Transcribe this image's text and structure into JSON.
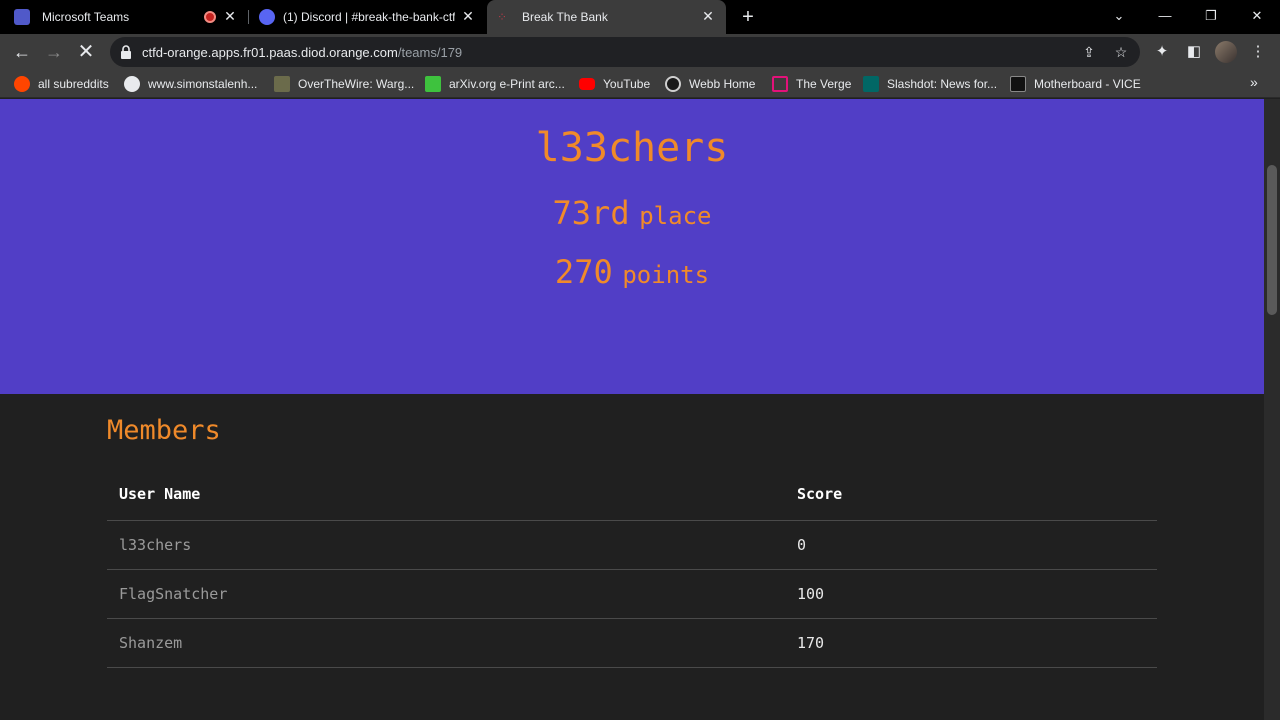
{
  "browser": {
    "tabs": [
      {
        "title": "Microsoft Teams",
        "favicon": "teams-icon",
        "color": "#5059c9"
      },
      {
        "title": "(1) Discord | #break-the-bank-ctf",
        "favicon": "discord-icon",
        "color": "#5865f2"
      },
      {
        "title": "Break The Bank",
        "favicon": "ctf-icon",
        "color": "#b23a48"
      }
    ],
    "url_host": "ctfd-orange.apps.fr01.paas.diod.orange.com",
    "url_path": "/teams/179",
    "bookmarks": [
      {
        "label": "all subreddits",
        "icon": "reddit-icon",
        "color": "#ff4500"
      },
      {
        "label": "www.simonstalenh...",
        "icon": "globe-icon",
        "color": "#e8eaed"
      },
      {
        "label": "OverTheWire: Warg...",
        "icon": "overthewire-icon",
        "color": "#6b6b4b"
      },
      {
        "label": "arXiv.org e-Print arc...",
        "icon": "arxiv-icon",
        "color": "#3ec23e"
      },
      {
        "label": "YouTube",
        "icon": "youtube-icon",
        "color": "#ff0000"
      },
      {
        "label": "Webb Home",
        "icon": "webb-icon",
        "color": "#1a1a1a"
      },
      {
        "label": "The Verge",
        "icon": "verge-icon",
        "color": "#e2127a"
      },
      {
        "label": "Slashdot: News for...",
        "icon": "slashdot-icon",
        "color": "#016765"
      },
      {
        "label": "Motherboard - VICE",
        "icon": "vice-icon",
        "color": "#111111"
      }
    ]
  },
  "team": {
    "name": "l33chers",
    "place_number": "73rd",
    "place_label": "place",
    "points_number": "270",
    "points_label": "points"
  },
  "members": {
    "title": "Members",
    "columns": [
      "User Name",
      "Score"
    ],
    "rows": [
      {
        "user": "l33chers",
        "score": "0"
      },
      {
        "user": "FlagSnatcher",
        "score": "100"
      },
      {
        "user": "Shanzem",
        "score": "170"
      }
    ]
  },
  "colors": {
    "hero_bg": "#513ec6",
    "accent_orange": "#f08a2a",
    "page_bg": "#202020"
  }
}
